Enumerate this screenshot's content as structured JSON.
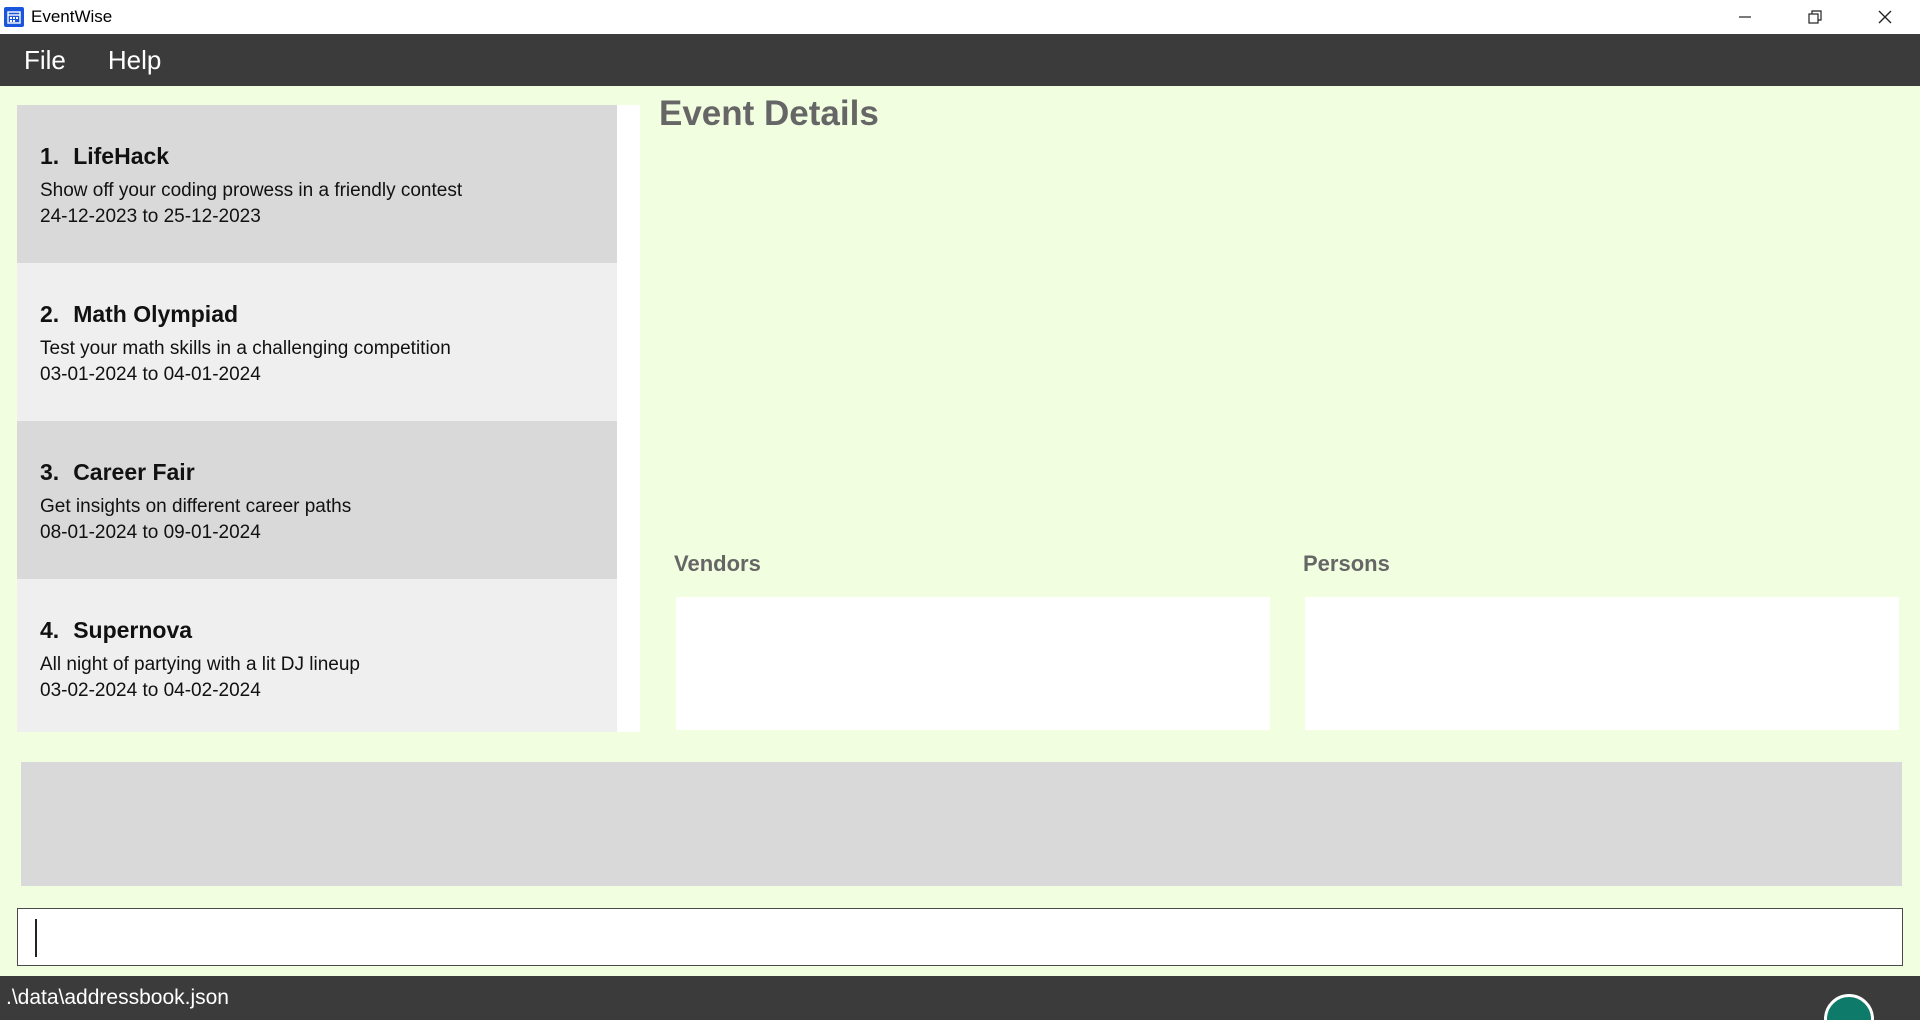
{
  "window": {
    "title": "EventWise"
  },
  "menu": {
    "file_label": "File",
    "help_label": "Help"
  },
  "events": [
    {
      "index": "1.",
      "name": "LifeHack",
      "description": "Show off your coding prowess in a friendly contest",
      "dates": "24-12-2023 to 25-12-2023"
    },
    {
      "index": "2.",
      "name": "Math Olympiad",
      "description": "Test your math skills in a challenging competition",
      "dates": "03-01-2024 to 04-01-2024"
    },
    {
      "index": "3.",
      "name": "Career Fair",
      "description": "Get insights on different career paths",
      "dates": "08-01-2024 to 09-01-2024"
    },
    {
      "index": "4.",
      "name": "Supernova",
      "description": "All night of partying with a lit DJ lineup",
      "dates": "03-02-2024 to 04-02-2024"
    }
  ],
  "details": {
    "title": "Event Details",
    "vendors_label": "Vendors",
    "persons_label": "Persons"
  },
  "command": {
    "value": ""
  },
  "status": {
    "path": ".\\data\\addressbook.json"
  },
  "colors": {
    "background": "#f1ffe0",
    "menubar": "#3b3b3b",
    "card_dark": "#d9d9d9",
    "card_light": "#efefef",
    "heading": "#666666",
    "app_icon": "#1a56db",
    "badge": "#0e7a6a"
  },
  "icons": {
    "app": "calendar-icon",
    "minimize": "minimize-icon",
    "maximize": "restore-icon",
    "close": "close-icon"
  }
}
